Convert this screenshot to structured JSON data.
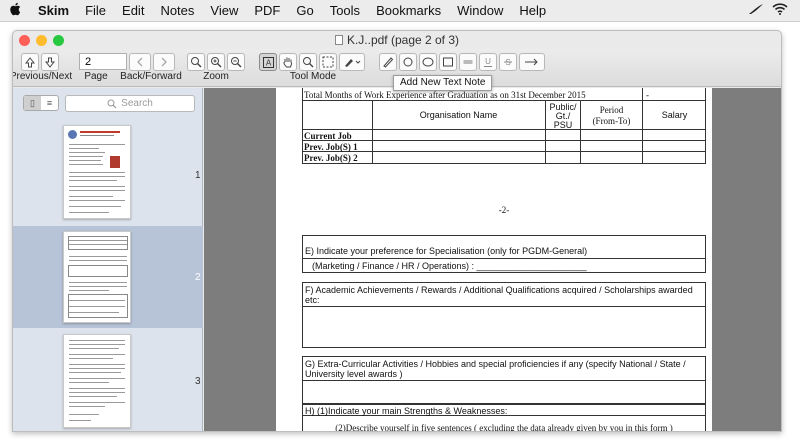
{
  "menubar": {
    "app_name": "Skim",
    "items": [
      "File",
      "Edit",
      "Notes",
      "View",
      "PDF",
      "Go",
      "Tools",
      "Bookmarks",
      "Window",
      "Help"
    ]
  },
  "window": {
    "title": "K.J..pdf (page 2 of 3)",
    "traffic_colors": [
      "#fe5f57",
      "#febc2e",
      "#28c840"
    ]
  },
  "toolbar": {
    "page_value": "2",
    "labels": {
      "prev_next": "Previous/Next",
      "page": "Page",
      "back_forward": "Back/Forward",
      "zoom": "Zoom",
      "tool_mode": "Tool Mode"
    },
    "tooltip": "Add New Text Note"
  },
  "sidebar": {
    "search_placeholder": "Search",
    "thumbnails": [
      {
        "label": "1",
        "selected": false
      },
      {
        "label": "2",
        "selected": true
      },
      {
        "label": "3",
        "selected": false
      }
    ]
  },
  "document": {
    "row_total_months": "Total Months of Work Experience after Graduation as on 31st December 2015",
    "row_total_dash": "-",
    "col_org": "Organisation Name",
    "col_public_1": "Public/",
    "col_public_2": "Gt./",
    "col_public_3": "PSU",
    "col_period_1": "Period",
    "col_period_2": "(From-To)",
    "col_salary": "Salary",
    "row_current": "Current Job",
    "row_prev1": "Prev. Job(S) 1",
    "row_prev2": "Prev. Job(S) 2",
    "page_marker": "-2-",
    "section_e_title": "E) Indicate your preference for Specialisation (only for PGDM-General)",
    "section_e_sub": "(Marketing / Finance / HR / Operations) :  ______________________",
    "section_f_title": "F) Academic Achievements / Rewards / Additional Qualifications acquired / Scholarships awarded etc:",
    "section_g_title": "G) Extra-Curricular Activities / Hobbies and special proficiencies if any (specify National / State / University level awards )",
    "section_h_title": "H) (1)Indicate your main Strengths & Weaknesses:",
    "section_h2_title": "(2)Describe yourself in five sentences ( excluding the data already given by you in this form )"
  }
}
